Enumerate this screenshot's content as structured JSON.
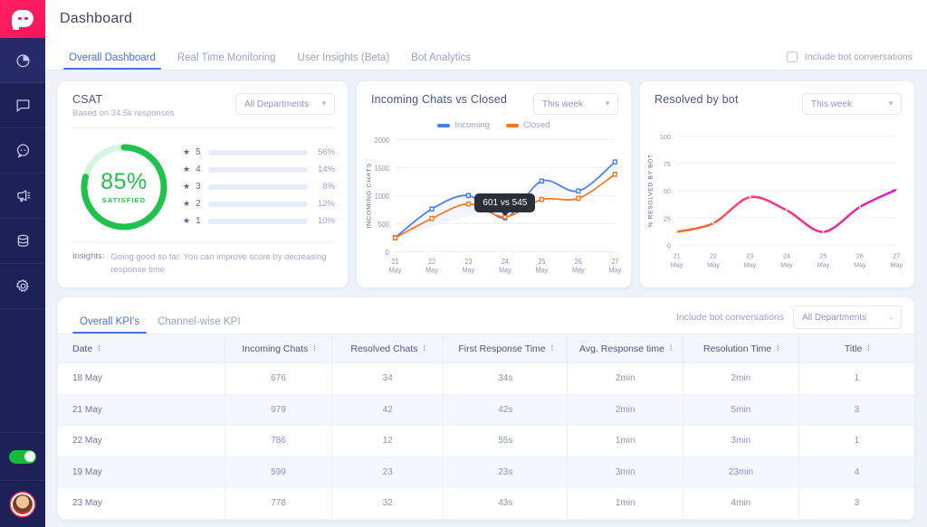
{
  "sidebar": {
    "logo": "chat-bubble-logo",
    "items": [
      {
        "name": "analytics",
        "icon": "pie-chart-icon",
        "active": true
      },
      {
        "name": "conversations",
        "icon": "message-icon",
        "active": false
      },
      {
        "name": "chatbot",
        "icon": "chat-dots-icon",
        "active": false
      },
      {
        "name": "campaigns",
        "icon": "megaphone-icon",
        "active": false
      },
      {
        "name": "data",
        "icon": "database-icon",
        "active": false
      },
      {
        "name": "settings",
        "icon": "gear-icon",
        "active": false
      }
    ],
    "availability_toggle": {
      "name": "availability-toggle",
      "state": "on"
    },
    "avatar": "user-avatar"
  },
  "header": {
    "title": "Dashboard"
  },
  "tabs": [
    {
      "label": "Overall Dashboard",
      "active": true
    },
    {
      "label": "Real Time Monitoring",
      "active": false
    },
    {
      "label": "User Insights (Beta)",
      "active": false
    },
    {
      "label": "Bot Analytics",
      "active": false
    }
  ],
  "bot_conversations": {
    "label": "Include bot conversations",
    "checked": false
  },
  "csat": {
    "title": "CSAT",
    "subtitle": "Based on 34.5k responses",
    "department_select": "All Departments",
    "score": "85%",
    "score_caption": "SATISFIED",
    "score_value": 85,
    "insights_key": "Insights:",
    "insights_text": "Going good so far. You can improve score by decreasing response time",
    "ratings": [
      {
        "stars": "5",
        "pct": "56%",
        "fill": 62
      },
      {
        "stars": "4",
        "pct": "14%",
        "fill": 22
      },
      {
        "stars": "3",
        "pct": "8%",
        "fill": 12
      },
      {
        "stars": "2",
        "pct": "12%",
        "fill": 19
      },
      {
        "stars": "1",
        "pct": "10%",
        "fill": 16
      }
    ]
  },
  "chats_card": {
    "title": "Incoming Chats vs Closed",
    "period_select": "This week",
    "tooltip": "601 vs 545"
  },
  "bot_card": {
    "title": "Resolved by bot",
    "period_select": "This week"
  },
  "kpi": {
    "tabs": [
      {
        "label": "Overall KPI's",
        "active": true
      },
      {
        "label": "Channel-wise KPI",
        "active": false
      }
    ],
    "include_bot_note": "Include bot conversations",
    "department_select": "All Departments",
    "columns": [
      "Date",
      "Incoming Chats",
      "Resolved Chats",
      "First Response Time",
      "Avg. Response time",
      "Resolution Time",
      "Title"
    ],
    "rows": [
      [
        "18 May",
        "676",
        "34",
        "34s",
        "2min",
        "2min",
        "1"
      ],
      [
        "21 May",
        "979",
        "42",
        "42s",
        "2min",
        "5min",
        "3"
      ],
      [
        "22 May",
        "786",
        "12",
        "55s",
        "1min",
        "3min",
        "1"
      ],
      [
        "19 May",
        "599",
        "23",
        "23s",
        "3min",
        "23min",
        "4"
      ],
      [
        "23 May",
        "778",
        "32",
        "43s",
        "1min",
        "4min",
        "3"
      ]
    ]
  },
  "colors": {
    "accent": "#4a6cf7",
    "brand_pink": "#f5145b",
    "sidebar": "#1e2058",
    "incoming": "#4a7ef0",
    "closed": "#f57722",
    "satisfied_green": "#1fc24a",
    "bot_line_start": "#f97316",
    "bot_line_end": "#e816b8"
  },
  "chart_data": [
    {
      "type": "line",
      "title": "Incoming Chats vs Closed",
      "xlabel": "",
      "ylabel": "INCOMING CHATS",
      "categories": [
        "21 May",
        "22 May",
        "23 May",
        "24 May",
        "25 May",
        "26 May",
        "27 May"
      ],
      "ylim": [
        0,
        2000
      ],
      "yticks": [
        0,
        500,
        1000,
        1500,
        2000
      ],
      "grid": true,
      "legend": [
        "Incoming",
        "Closed"
      ],
      "legend_position": "top-center",
      "series": [
        {
          "name": "Incoming",
          "color": "#4a7ef0",
          "values": [
            250,
            760,
            1000,
            601,
            1260,
            1080,
            1600
          ]
        },
        {
          "name": "Closed",
          "color": "#f57722",
          "values": [
            245,
            590,
            850,
            620,
            930,
            950,
            1380
          ]
        }
      ],
      "annotation": {
        "text": "601 vs 545",
        "at_category": "24 May"
      }
    },
    {
      "type": "line",
      "title": "Resolved by bot",
      "xlabel": "",
      "ylabel": "% RESOLVED BY BOT",
      "categories": [
        "21 May",
        "22 May",
        "23 May",
        "24 May",
        "25 May",
        "26 May",
        "27 May"
      ],
      "ylim": [
        0,
        100
      ],
      "yticks": [
        0,
        25,
        50,
        75,
        100
      ],
      "grid": true,
      "legend": [],
      "series": [
        {
          "name": "% Resolved by bot",
          "gradient": [
            "#f97316",
            "#e816b8"
          ],
          "values": [
            12,
            20,
            44,
            32,
            12,
            35,
            51
          ]
        }
      ]
    }
  ]
}
